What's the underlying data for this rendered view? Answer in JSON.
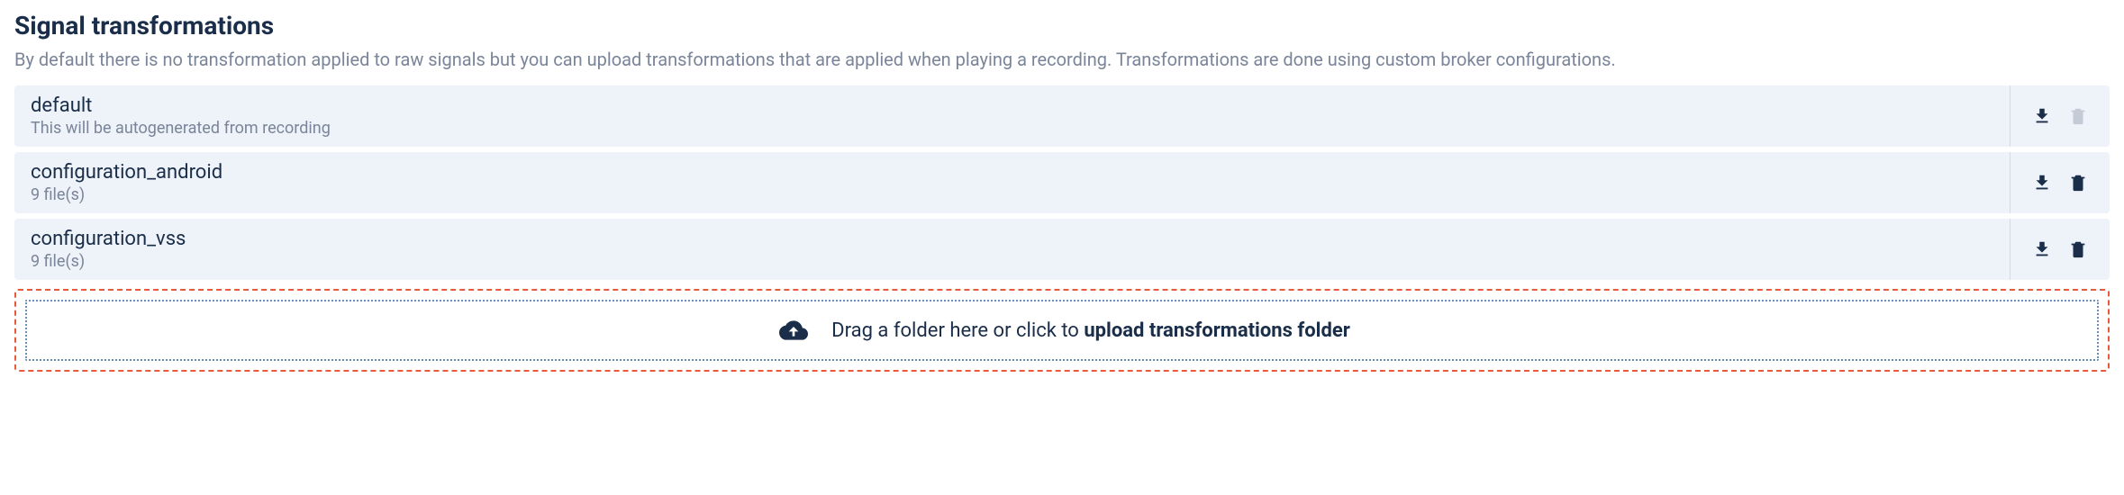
{
  "section": {
    "title": "Signal transformations",
    "description": "By default there is no transformation applied to raw signals but you can upload transformations that are applied when playing a recording. Transformations are done using custom broker configurations."
  },
  "configs": [
    {
      "name": "default",
      "sub": "This will be autogenerated from recording",
      "deletable": false
    },
    {
      "name": "configuration_android",
      "sub": "9 file(s)",
      "deletable": true
    },
    {
      "name": "configuration_vss",
      "sub": "9 file(s)",
      "deletable": true
    }
  ],
  "dropzone": {
    "prefix": "Drag a folder here or click to ",
    "bold": "upload transformations folder"
  }
}
